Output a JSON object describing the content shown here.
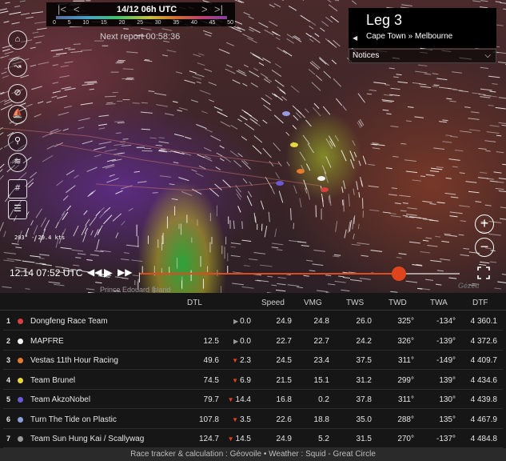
{
  "header": {
    "date": "14/12 06h UTC",
    "nav_first": "|<",
    "nav_prev": "<",
    "nav_next": ">",
    "nav_last": ">|",
    "scale_ticks": [
      "0",
      "5",
      "10",
      "15",
      "20",
      "25",
      "30",
      "35",
      "40",
      "45",
      "50"
    ],
    "next_report": "Next report 00:58:36"
  },
  "leg": {
    "title": "Leg 3",
    "from": "Cape Town",
    "separator": "»",
    "to": "Melbourne",
    "back_icon": "caret-left-icon"
  },
  "notices": {
    "label": "Notices",
    "icon": "chevron-down-icon"
  },
  "map": {
    "wind_readout": "203° - 29.4 kts",
    "island_label": "Prince Edouard Island",
    "logo_text": "Gézett"
  },
  "playback": {
    "time": "12.14 07:52 UTC",
    "progress": 0.81,
    "accent_color": "#e0441c"
  },
  "toolbar": [
    {
      "name": "map-icon",
      "glyph": "⌂"
    },
    {
      "name": "route-icon",
      "glyph": "↝"
    },
    {
      "name": "compass-icon",
      "glyph": "⊘"
    },
    {
      "name": "boat-icon",
      "glyph": "⛵"
    },
    {
      "name": "wind-icon",
      "glyph": "⚲"
    },
    {
      "name": "weather-icon",
      "glyph": "≋"
    },
    {
      "name": "grid-icon",
      "glyph": "#"
    },
    {
      "name": "layers-icon",
      "glyph": "☰"
    }
  ],
  "table": {
    "columns": [
      "DTL",
      "Speed",
      "VMG",
      "TWS",
      "TWD",
      "TWA",
      "DTF"
    ],
    "rows": [
      {
        "rank": "1",
        "team": "Dongfeng Race Team",
        "color": "#d94040",
        "dtl": "",
        "delta": "0.0",
        "trend": "flat",
        "speed": "24.9",
        "vmg": "24.8",
        "tws": "26.0",
        "twd": "325°",
        "twa": "-134°",
        "dtf": "4 360.1"
      },
      {
        "rank": "2",
        "team": "MAPFRE",
        "color": "#f2f2f2",
        "dtl": "12.5",
        "delta": "0.0",
        "trend": "flat",
        "speed": "22.7",
        "vmg": "22.7",
        "tws": "24.2",
        "twd": "326°",
        "twa": "-139°",
        "dtf": "4 372.6"
      },
      {
        "rank": "3",
        "team": "Vestas 11th Hour Racing",
        "color": "#e87a30",
        "dtl": "49.6",
        "delta": "2.3",
        "trend": "down",
        "speed": "24.5",
        "vmg": "23.4",
        "tws": "37.5",
        "twd": "311°",
        "twa": "-149°",
        "dtf": "4 409.7"
      },
      {
        "rank": "4",
        "team": "Team Brunel",
        "color": "#e8d840",
        "dtl": "74.5",
        "delta": "6.9",
        "trend": "down",
        "speed": "21.5",
        "vmg": "15.1",
        "tws": "31.2",
        "twd": "299°",
        "twa": "139°",
        "dtf": "4 434.6"
      },
      {
        "rank": "5",
        "team": "Team AkzoNobel",
        "color": "#6a5ad8",
        "dtl": "79.7",
        "delta": "14.4",
        "trend": "down",
        "speed": "16.8",
        "vmg": "0.2",
        "tws": "37.8",
        "twd": "311°",
        "twa": "130°",
        "dtf": "4 439.8"
      },
      {
        "rank": "6",
        "team": "Turn The Tide on Plastic",
        "color": "#8aa0d8",
        "dtl": "107.8",
        "delta": "3.5",
        "trend": "down",
        "speed": "22.6",
        "vmg": "18.8",
        "tws": "35.0",
        "twd": "288°",
        "twa": "135°",
        "dtf": "4 467.9"
      },
      {
        "rank": "7",
        "team": "Team Sun Hung Kai / Scallywag",
        "color": "#9a9a9a",
        "dtl": "124.7",
        "delta": "14.5",
        "trend": "down",
        "speed": "24.9",
        "vmg": "5.2",
        "tws": "31.5",
        "twd": "270°",
        "twa": "-137°",
        "dtf": "4 484.8"
      }
    ]
  },
  "footer": "Race tracker & calculation : Géovoile • Weather : Squid - Great Circle"
}
